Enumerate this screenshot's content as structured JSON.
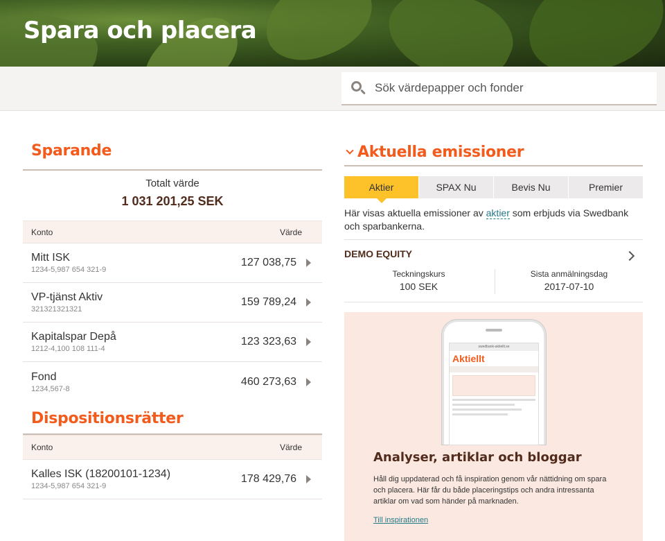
{
  "header": {
    "title": "Spara och placera"
  },
  "search": {
    "placeholder": "Sök värdepapper och fonder"
  },
  "sparande": {
    "title": "Sparande",
    "total_label": "Totalt värde",
    "total_value": "1 031 201,25 SEK",
    "col_konto": "Konto",
    "col_varde": "Värde",
    "accounts": [
      {
        "name": "Mitt ISK",
        "number": "1234-5,987 654 321-9",
        "value": "127 038,75"
      },
      {
        "name": "VP-tjänst Aktiv",
        "number": "321321321321",
        "value": "159 789,24"
      },
      {
        "name": "Kapitalspar Depå",
        "number": "1212-4,100 108 111-4",
        "value": "123 323,63"
      },
      {
        "name": "Fond",
        "number": "1234,567-8",
        "value": "460 273,63"
      }
    ]
  },
  "disp": {
    "title": "Dispositionsrätter",
    "col_konto": "Konto",
    "col_varde": "Värde",
    "accounts": [
      {
        "name": "Kalles ISK (18200101-1234)",
        "number": "1234-5,987 654 321-9",
        "value": "178 429,76"
      }
    ]
  },
  "emissioner": {
    "title": "Aktuella emissioner",
    "tabs": [
      "Aktier",
      "SPAX Nu",
      "Bevis Nu",
      "Premier"
    ],
    "active_tab": "Aktier",
    "intro_before": "Här visas aktuella emissioner av ",
    "intro_link": "aktier",
    "intro_after": " som erbjuds via Swedbank och sparbankerna.",
    "equity": {
      "name": "DEMO EQUITY",
      "col1_label": "Teckningskurs",
      "col1_value": "100 SEK",
      "col2_label": "Sista anmälningsdag",
      "col2_value": "2017-07-10"
    }
  },
  "promo": {
    "phone_url": "swedbank-aktiellt.se",
    "phone_brand": "Aktiellt",
    "title": "Analyser, artiklar och bloggar",
    "text": "Håll dig uppdaterad och få inspiration genom vår nättidning om spara och placera. Här får du både placeringstips och andra intressanta artiklar om vad som händer på marknaden.",
    "link": "Till inspirationen"
  },
  "colors": {
    "accent": "#f35b1c",
    "brand_brown": "#512b1b",
    "tab_active": "#fdc129",
    "link": "#257886"
  }
}
